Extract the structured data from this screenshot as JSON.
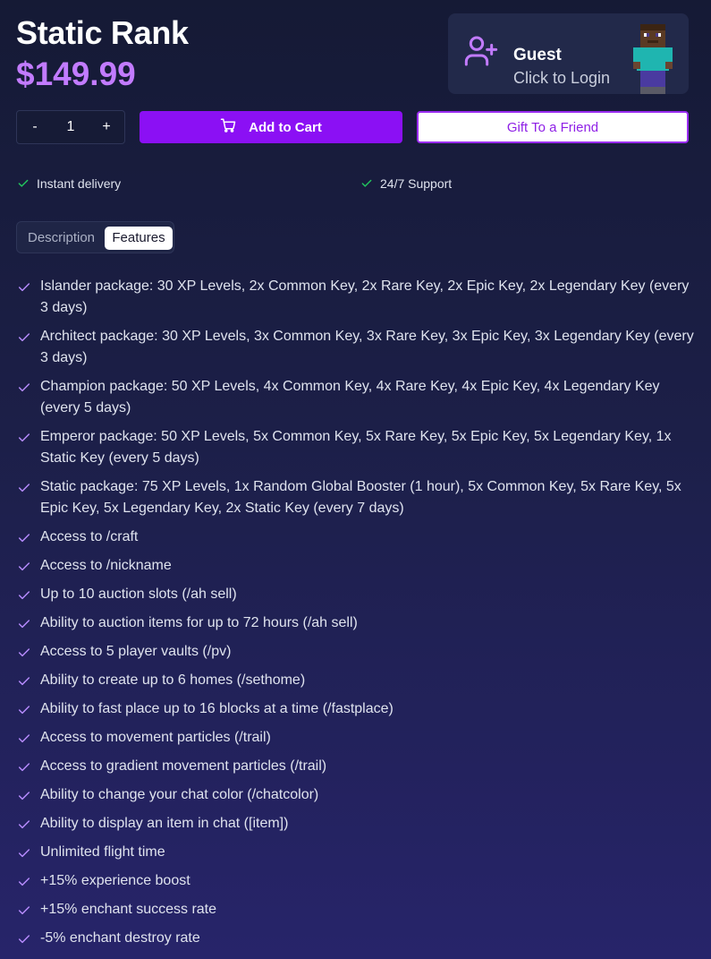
{
  "product": {
    "title": "Static Rank",
    "price": "$149.99"
  },
  "user": {
    "name": "Guest",
    "login_text": "Click to Login",
    "icon": "user-plus-icon"
  },
  "quantity": {
    "minus_label": "-",
    "value": "1",
    "plus_label": "+"
  },
  "actions": {
    "add_to_cart": "Add to Cart",
    "gift": "Gift To a Friend"
  },
  "perks": [
    "Instant delivery",
    "24/7 Support"
  ],
  "tabs": [
    {
      "label": "Description",
      "active": false
    },
    {
      "label": "Features",
      "active": true
    }
  ],
  "features": [
    "Islander package: 30 XP Levels, 2x Common Key, 2x Rare Key, 2x Epic Key, 2x Legendary Key (every 3 days)",
    "Architect package: 30 XP Levels, 3x Common Key, 3x Rare Key, 3x Epic Key, 3x Legendary Key (every 3 days)",
    "Champion package: 50 XP Levels, 4x Common Key, 4x Rare Key, 4x Epic Key, 4x Legendary Key (every 5 days)",
    "Emperor package: 50 XP Levels, 5x Common Key, 5x Rare Key, 5x Epic Key, 5x Legendary Key, 1x Static Key (every 5 days)",
    "Static package: 75 XP Levels, 1x Random Global Booster (1 hour), 5x Common Key, 5x Rare Key, 5x Epic Key, 5x Legendary Key, 2x Static Key (every 7 days)",
    "Access to /craft",
    "Access to /nickname",
    "Up to 10 auction slots (/ah sell)",
    "Ability to auction items for up to 72 hours (/ah sell)",
    "Access to 5 player vaults (/pv)",
    "Ability to create up to 6 homes (/sethome)",
    "Ability to fast place up to 16 blocks at a time (/fastplace)",
    "Access to movement particles (/trail)",
    "Access to gradient movement particles (/trail)",
    "Ability to change your chat color (/chatcolor)",
    "Ability to display an item in chat ([item])",
    "Unlimited flight time",
    "+15% experience boost",
    "+15% enchant success rate",
    "-5% enchant destroy rate"
  ],
  "colors": {
    "accent": "#8b10f4",
    "price": "#c27bff",
    "check_green": "#22c55e",
    "check_purple": "#b78cff"
  }
}
